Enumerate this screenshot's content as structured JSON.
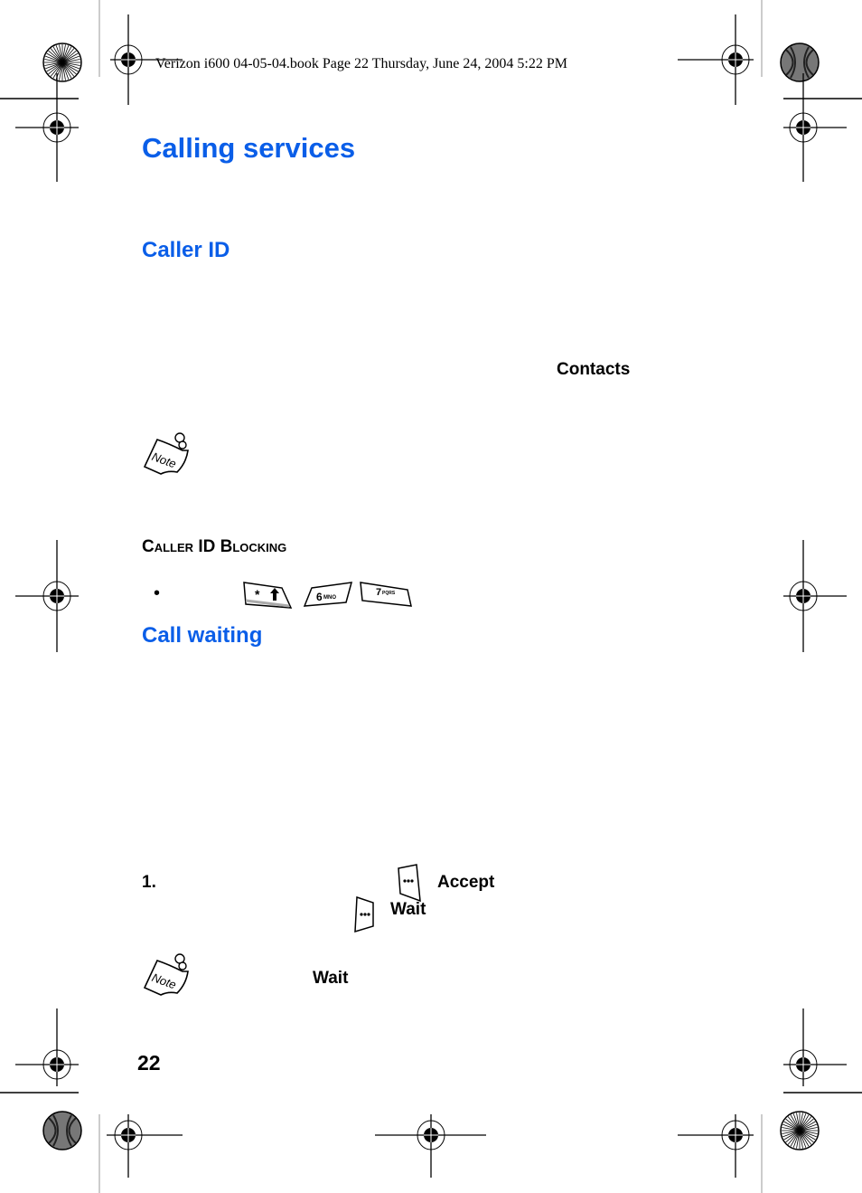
{
  "header": {
    "book_info": "Verizon i600 04-05-04.book  Page 22  Thursday, June 24, 2004  5:22 PM"
  },
  "page": {
    "title": "Calling services",
    "sections": [
      {
        "heading": "Caller ID",
        "visible_terms": [
          "Contacts"
        ],
        "has_note_icon": true,
        "subsection": {
          "heading": "Caller ID Blocking",
          "bullet": "•",
          "keys": [
            {
              "icon": "star-shift-key-icon",
              "label": "* ↑"
            },
            {
              "icon": "six-key-icon",
              "label": "6MNO"
            },
            {
              "icon": "seven-key-icon",
              "label": "7PQRS"
            }
          ]
        }
      },
      {
        "heading": "Call waiting",
        "steps": [
          {
            "number": "1.",
            "softkeys": [
              {
                "icon": "left-softkey-icon",
                "label": "Accept"
              },
              {
                "icon": "right-softkey-icon",
                "label": "Wait"
              }
            ]
          }
        ],
        "note": {
          "visible_term": "Wait"
        }
      }
    ],
    "page_number": "22"
  },
  "colors": {
    "heading": "#0a5ee8",
    "text": "#000000"
  }
}
